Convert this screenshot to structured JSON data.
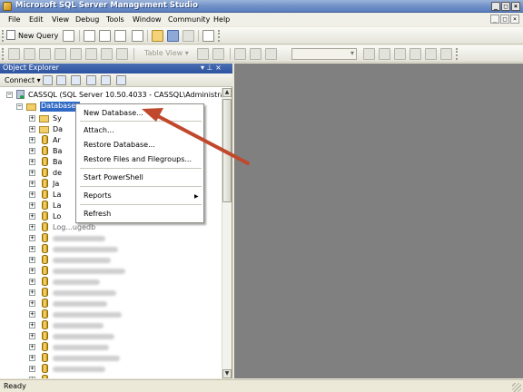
{
  "window": {
    "title": "Microsoft SQL Server Management Studio",
    "min_glyph": "_",
    "max_glyph": "□",
    "close_glyph": "×",
    "accent_color": "#316ac5"
  },
  "menu": {
    "items": [
      "File",
      "Edit",
      "View",
      "Debug",
      "Tools",
      "Window",
      "Community",
      "Help"
    ],
    "doc_controls": [
      "_",
      "□",
      "×"
    ]
  },
  "toolbar1": {
    "new_query": "New Query"
  },
  "toolbar2": {
    "table_view": "Table View ▾",
    "dropdown_value": ""
  },
  "object_explorer": {
    "title": "Object Explorer",
    "pin_glyph": "▾ ⊥ ×",
    "connect": "Connect ▾",
    "server_node": "CASSQL (SQL Server 10.50.4033 - CASSQL\\Administrator)",
    "databases_node": "Databases",
    "visible_items": [
      "Sy",
      "Da",
      "Ar",
      "Ba",
      "Ba",
      "de",
      "Ja",
      "La",
      "La",
      "Lo",
      "Log...ugedb"
    ]
  },
  "context_menu": {
    "new_database": "New Database...",
    "attach": "Attach...",
    "restore_database": "Restore Database...",
    "restore_files": "Restore Files and Filegroups...",
    "start_powershell": "Start PowerShell",
    "reports": "Reports",
    "refresh": "Refresh",
    "submenu_glyph": "▶"
  },
  "status": {
    "text": "Ready"
  },
  "annotation": {
    "arrow_color": "#c0482c"
  }
}
